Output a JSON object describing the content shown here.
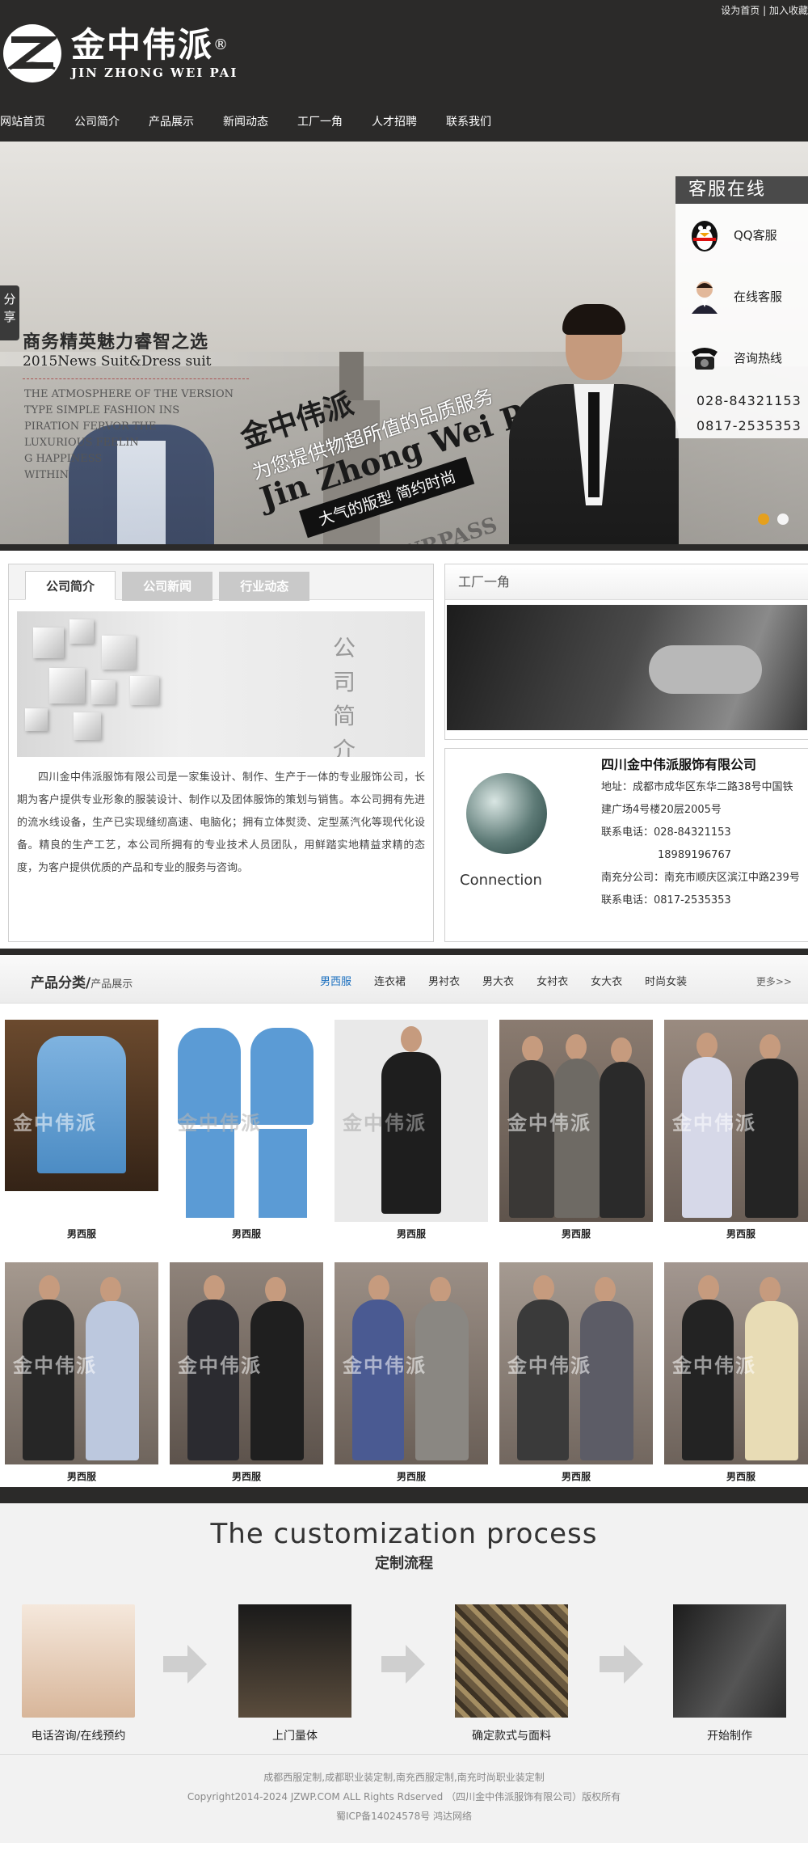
{
  "header": {
    "top_links": [
      "设为首页",
      "|",
      "加入收藏"
    ],
    "logo_cn": "金中伟派",
    "logo_reg": "®",
    "logo_en": "JIN ZHONG WEI PAI",
    "nav": [
      "网站首页",
      "公司简介",
      "产品展示",
      "新闻动态",
      "工厂一角",
      "人才招聘",
      "联系我们"
    ]
  },
  "banner": {
    "share": "分享",
    "title": "商务精英魅力睿智之选",
    "subtitle": "2015News Suit&Dress suit",
    "paragraph": "THE ATMOSPHERE OF THE VERSION\nTYPE SIMPLE FASHION INS\nPIRATION FERVOR THE\nLUXURIOUS FEELIN\nG HAPPINESS\nWITHIN",
    "slogan_brand": "金中伟派",
    "slogan_sub": "为您提供物超所值的品质服务",
    "slogan_en": "Jin Zhong Wei Pai",
    "slogan_bar": "大气的版型  简约时尚",
    "ghost": "SURPASS"
  },
  "service": {
    "title": "客服在线",
    "qq": "QQ客服",
    "online": "在线客服",
    "hotline": "咨询热线",
    "phones": [
      "028-84321153",
      "0817-2535353"
    ]
  },
  "intro": {
    "tabs": [
      "公司简介",
      "公司新闻",
      "行业动态"
    ],
    "caption": "公司简介",
    "text": "四川金中伟派服饰有限公司是一家集设计、制作、生产于一体的专业服饰公司，长期为客户提供专业形象的服装设计、制作以及团体服饰的策划与销售。本公司拥有先进的流水线设备，生产已实现缝纫高速、电脑化；拥有立体熨烫、定型蒸汽化等现代化设备。精良的生产工艺，本公司所拥有的专业技术人员团队，用鲜踏实地精益求精的态度，为客户提供优质的产品和专业的服务与咨询。"
  },
  "factory": {
    "title": "工厂一角"
  },
  "contact": {
    "globe_word": "Connection",
    "company": "四川金中伟派服饰有限公司",
    "address": "地址：成都市成华区东华二路38号中国铁建广场4号楼20层2005号",
    "phone_label": "联系电话：028-84321153",
    "phone2": "18989196767",
    "branch": "南充分公司：南充市顺庆区滨江中路239号",
    "branch_phone": "联系电话：0817-2535353"
  },
  "products": {
    "heading": "产品分类/",
    "heading_small": "产品展示",
    "categories": [
      "男西服",
      "连衣裙",
      "男衬衣",
      "男大衣",
      "女衬衣",
      "女大衣",
      "时尚女装"
    ],
    "more": "更多>>",
    "items": [
      "男西服",
      "男西服",
      "男西服",
      "男西服",
      "男西服",
      "男西服",
      "男西服",
      "男西服",
      "男西服",
      "男西服"
    ]
  },
  "process": {
    "title": "The customization process",
    "subtitle": "定制流程",
    "steps": [
      "电话咨询/在线预约",
      "上门量体",
      "确定款式与面料",
      "开始制作"
    ]
  },
  "footer": {
    "line1": "成都西服定制,成都职业装定制,南充西服定制,南充时尚职业装定制",
    "line2": "Copyright2014-2024 JZWP.COM ALL Rights Rdserved （四川金中伟派服饰有限公司）版权所有",
    "line3": "蜀ICP备14024578号 鸿达网络"
  },
  "colors": {
    "dark": "#2b2a29",
    "accent_blue": "#1a6fbf",
    "dot_active": "#e5a01e"
  }
}
